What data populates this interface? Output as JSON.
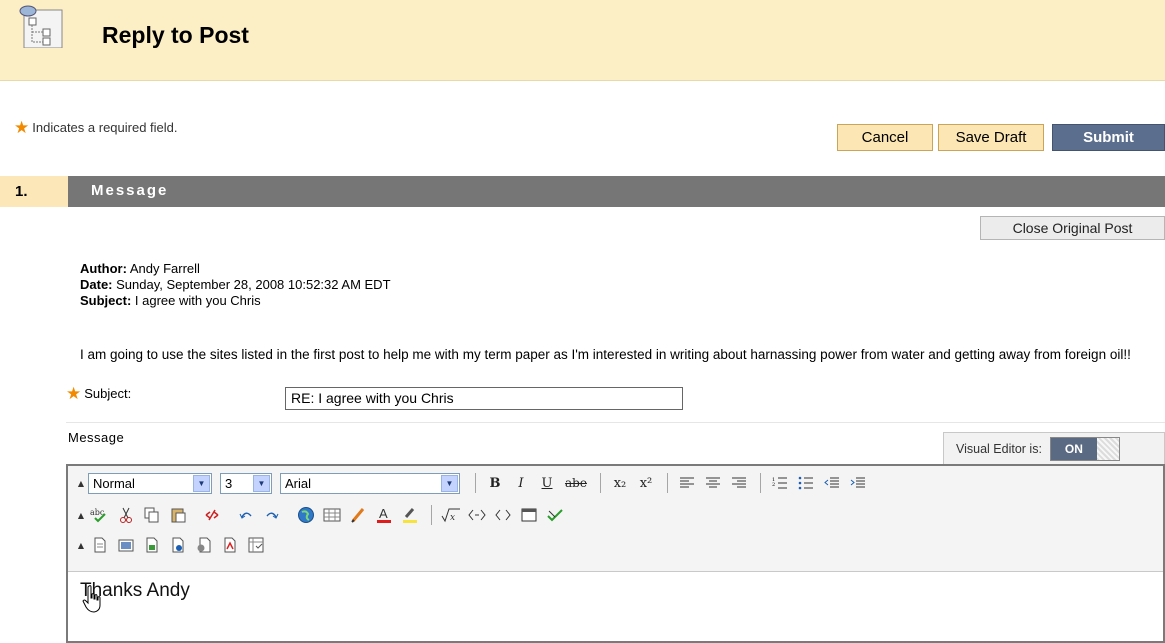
{
  "header": {
    "title": "Reply to Post"
  },
  "required_note": {
    "star": "★",
    "text": "Indicates a required field."
  },
  "actions": {
    "cancel": "Cancel",
    "save_draft": "Save Draft",
    "submit": "Submit"
  },
  "section": {
    "number": "1.",
    "title": "Message"
  },
  "close_original": "Close Original Post",
  "original_post": {
    "author_label": "Author:",
    "author": " Andy Farrell",
    "date_label": "Date:",
    "date": " Sunday, September 28, 2008 10:52:32 AM EDT",
    "subject_label": "Subject:",
    "subject": " I agree with you Chris",
    "body": "I am going to use the sites listed in the first post to help me with my term paper as I'm interested in writing about harnassing power from water and getting away from foreign oil!!"
  },
  "form": {
    "subject_label": "Subject:",
    "subject_value": "RE: I agree with you Chris",
    "message_label": "Message"
  },
  "visual_editor": {
    "label": "Visual Editor is:",
    "state": "ON"
  },
  "editor": {
    "format": "Normal",
    "size": "3",
    "font": "Arial",
    "content": "Thanks Andy",
    "toolbar_row1": [
      "B",
      "I",
      "U",
      "abe",
      "x₂",
      "x²"
    ],
    "toolbar_row2_icons": [
      "spellcheck-icon",
      "cut-icon",
      "copy-icon",
      "paste-icon",
      "unlink-icon",
      "undo-icon",
      "redo-icon",
      "globe-icon",
      "table-icon",
      "pencil-icon",
      "font-color-icon",
      "highlight-icon",
      "math-icon",
      "code-view-icon",
      "html-icon",
      "preview-icon",
      "check-icon"
    ],
    "toolbar_row3_icons": [
      "insert-file-icon",
      "insert-image-icon",
      "insert-media-icon",
      "insert-link-icon",
      "insert-audio-icon",
      "insert-pdf-icon",
      "insert-mashup-icon"
    ]
  },
  "colors": {
    "header_bg": "#fcefc5",
    "section_bar": "#767676",
    "submit": "#5c6e8e",
    "star": "#f18a00"
  }
}
